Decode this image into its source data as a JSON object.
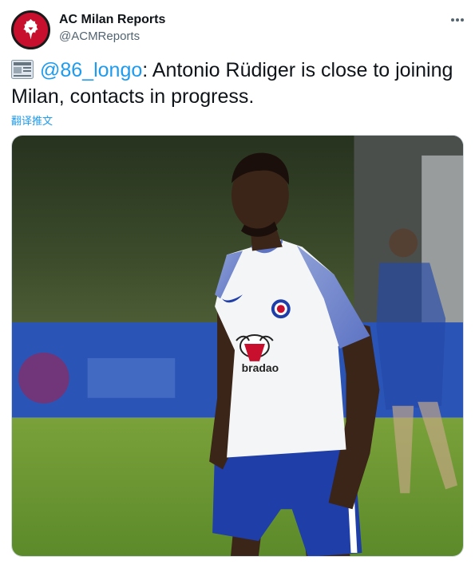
{
  "author": {
    "name": "AC Milan Reports",
    "handle": "@ACMReports"
  },
  "tweet": {
    "mention": "@86_longo",
    "text": ": Antonio Rüdiger is close to joining Milan, contacts in progress."
  },
  "translate_label": "翻译推文",
  "media": {
    "sponsor_text": "bradao"
  },
  "icons": {
    "avatar": "devil-crest-icon",
    "news": "newspaper-icon",
    "more": "more-dots-icon"
  },
  "colors": {
    "accent": "#1d9bf0",
    "avatar_red": "#c8102e",
    "kit_blue": "#1f3ea8"
  }
}
